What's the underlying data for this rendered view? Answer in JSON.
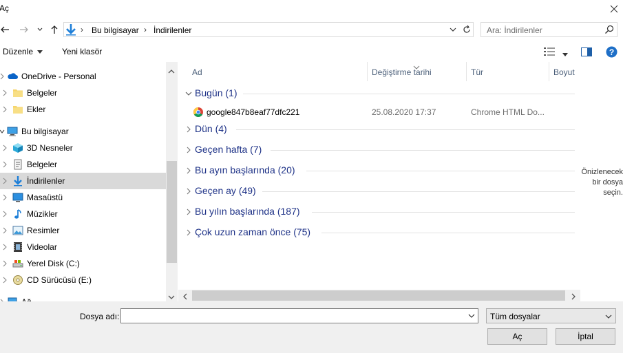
{
  "window": {
    "title": "Aç"
  },
  "address": {
    "crumbs": [
      "Bu bilgisayar",
      "İndirilenler"
    ]
  },
  "search": {
    "placeholder": "Ara: İndirilenler"
  },
  "toolbar": {
    "organize": "Düzenle",
    "new_folder": "Yeni klasör"
  },
  "nav": {
    "items": [
      {
        "label": "OneDrive - Personal",
        "icon": "cloud-icon"
      },
      {
        "label": "Belgeler",
        "icon": "folder-icon"
      },
      {
        "label": "Ekler",
        "icon": "folder-icon"
      },
      {
        "label": "Bu bilgisayar",
        "icon": "computer-icon"
      },
      {
        "label": "3D Nesneler",
        "icon": "cube-icon"
      },
      {
        "label": "Belgeler",
        "icon": "documents-icon"
      },
      {
        "label": "İndirilenler",
        "icon": "download-icon"
      },
      {
        "label": "Masaüstü",
        "icon": "desktop-icon"
      },
      {
        "label": "Müzikler",
        "icon": "music-icon"
      },
      {
        "label": "Resimler",
        "icon": "pictures-icon"
      },
      {
        "label": "Videolar",
        "icon": "video-icon"
      },
      {
        "label": "Yerel Disk (C:)",
        "icon": "disk-icon"
      },
      {
        "label": "CD Sürücüsü (E:)",
        "icon": "cd-icon"
      },
      {
        "label": "Ağ",
        "icon": "network-icon"
      }
    ]
  },
  "columns": {
    "name": "Ad",
    "date": "Değiştirme tarihi",
    "type": "Tür",
    "size": "Boyut"
  },
  "groups": [
    {
      "label": "Bugün (1)",
      "expanded": true
    },
    {
      "label": "Dün (4)",
      "expanded": false
    },
    {
      "label": "Geçen hafta (7)",
      "expanded": false
    },
    {
      "label": "Bu ayın başlarında (20)",
      "expanded": false
    },
    {
      "label": "Geçen ay (49)",
      "expanded": false
    },
    {
      "label": "Bu yılın başlarında (187)",
      "expanded": false
    },
    {
      "label": "Çok uzun zaman önce (75)",
      "expanded": false
    }
  ],
  "files": [
    {
      "name": "google847b8eaf77dfc221",
      "date": "25.08.2020 17:37",
      "type": "Chrome HTML Do...",
      "icon": "chrome-icon"
    }
  ],
  "preview": {
    "text": "Önizlenecek\nbir dosya\nseçin."
  },
  "bottom": {
    "filename_label": "Dosya adı:",
    "filename_value": "",
    "filter_value": "Tüm dosyalar",
    "open_label": "Aç",
    "cancel_label": "İptal"
  },
  "colors": {
    "accent": "#0078d7",
    "group_text": "#1e3287",
    "selection": "#d9d9d9"
  }
}
